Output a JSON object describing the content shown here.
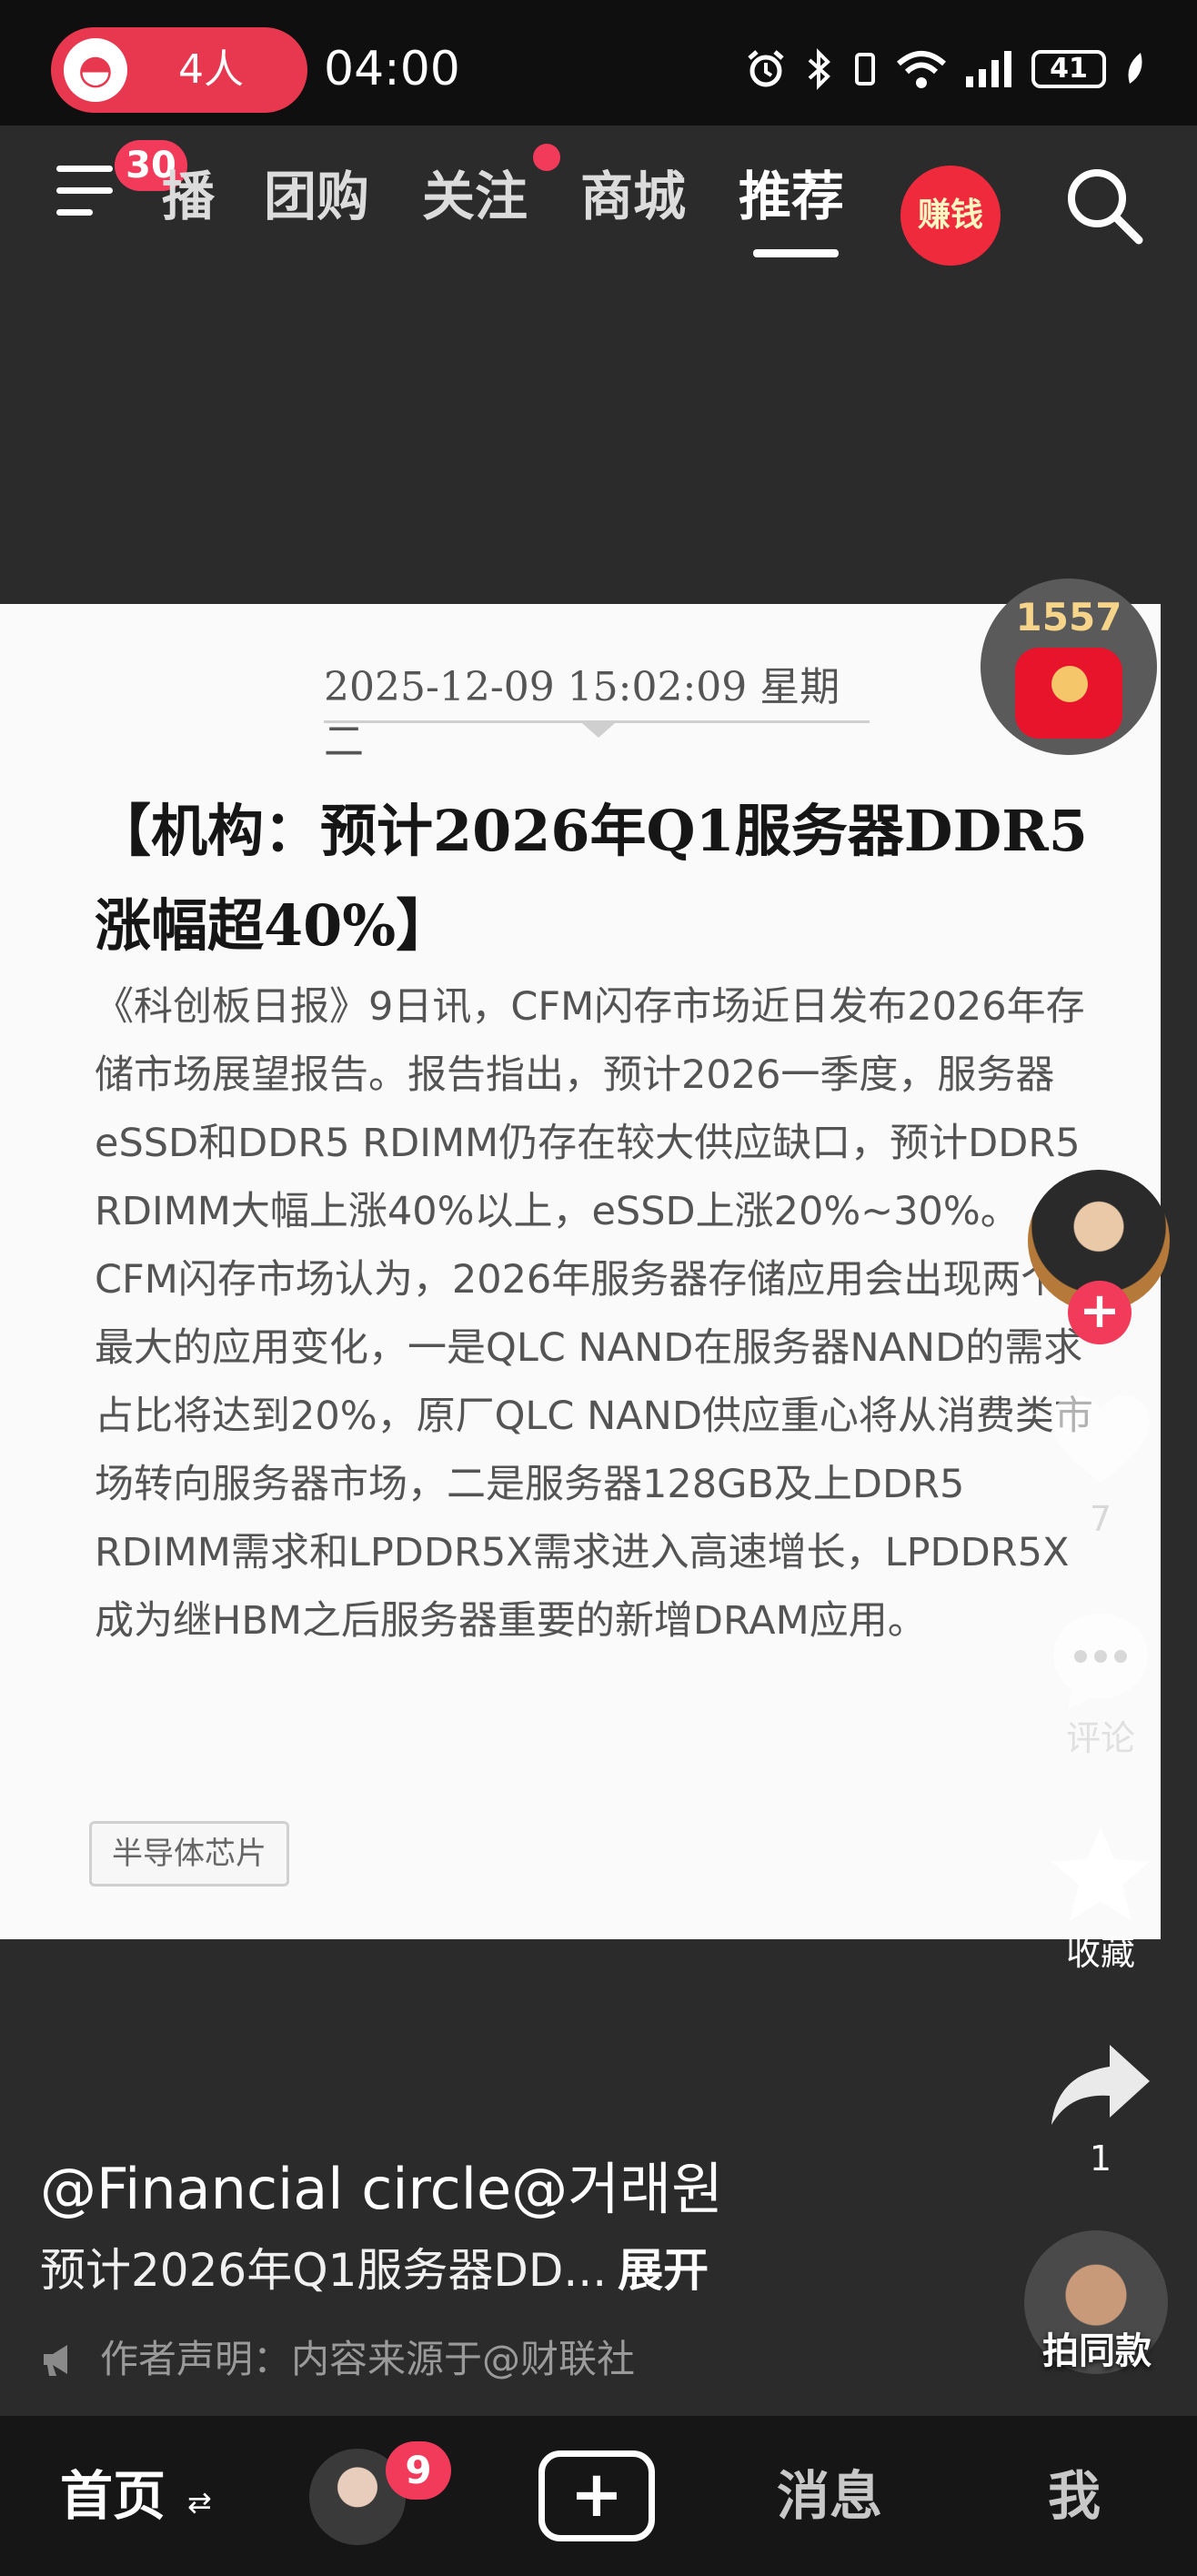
{
  "status_bar": {
    "live_count": "4人",
    "time": "04:00",
    "battery": "41"
  },
  "top_nav": {
    "menu_badge": "30",
    "tabs": [
      {
        "label": "播"
      },
      {
        "label": "团购"
      },
      {
        "label": "关注"
      },
      {
        "label": "商城"
      },
      {
        "label": "推荐"
      }
    ],
    "active_tab": "推荐",
    "earn_label": "赚钱"
  },
  "card": {
    "date": "2025-12-09 15:02:09 星期二",
    "title": "【机构：预计2026年Q1服务器DDR5涨幅超40%】",
    "body": "《科创板日报》9日讯，CFM闪存市场近日发布2026年存储市场展望报告。报告指出，预计2026一季度，服务器eSSD和DDR5 RDIMM仍存在较大供应缺口，预计DDR5 RDIMM大幅上涨40%以上，eSSD上涨20%~30%。CFM闪存市场认为，2026年服务器存储应用会出现两个最大的应用变化，一是QLC NAND在服务器NAND的需求占比将达到20%，原厂QLC NAND供应重心将从消费类市场转向服务器市场，二是服务器128GB及上DDR5 RDIMM需求和LPDDR5X需求进入高速增长，LPDDR5X成为继HBM之后服务器重要的新增DRAM应用。",
    "tag": "半导体芯片"
  },
  "side": {
    "redpacket_count": "1557",
    "like_count": "7",
    "comment_label": "评论",
    "favorite_label": "收藏",
    "share_count": "1",
    "same_style_label": "拍同款"
  },
  "caption": {
    "author": "@Financial circle@거래원",
    "text": "预计2026年Q1服务器DD...",
    "expand": "展开",
    "declaration": "作者声明：内容来源于@财联社"
  },
  "bottom_nav": {
    "home": "首页",
    "friend_badge": "9",
    "message": "消息",
    "me": "我"
  }
}
